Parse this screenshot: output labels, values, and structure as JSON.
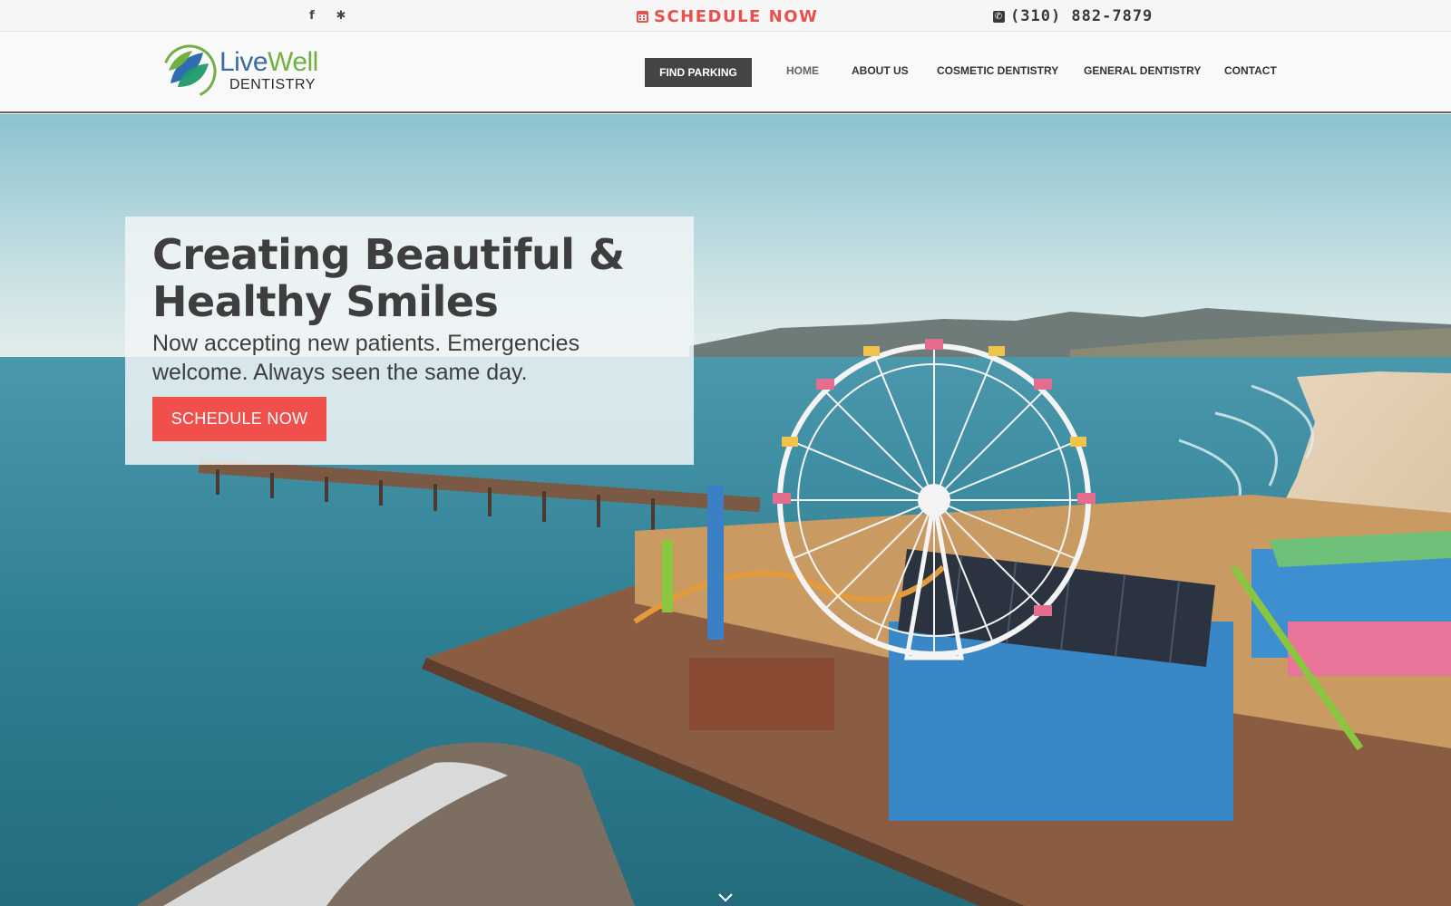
{
  "topbar": {
    "social": [
      {
        "name": "facebook-icon",
        "glyph": "f"
      },
      {
        "name": "yelp-icon",
        "glyph": "✱"
      }
    ],
    "schedule_label": "SCHEDULE NOW",
    "phone": "(310) 882-7879"
  },
  "header": {
    "logo": {
      "live": "Live",
      "well": "Well",
      "dentistry": "DENTISTRY"
    },
    "find_parking_label": "FIND PARKING",
    "nav": [
      "HOME",
      "ABOUT US",
      "COSMETIC DENTISTRY",
      "GENERAL DENTISTRY",
      "CONTACT"
    ],
    "active_nav": "HOME"
  },
  "hero": {
    "title": "Creating Beautiful & Healthy Smiles",
    "subtitle": "Now accepting new patients. Emergencies welcome. Always seen the same day.",
    "cta_label": "SCHEDULE NOW"
  },
  "colors": {
    "accent_red": "#f04f4c",
    "schedule_red": "#e8504c",
    "nav_dark": "#444444",
    "logo_blue": "#3b6aa8",
    "logo_green": "#72b042"
  },
  "icons": [
    "facebook-icon",
    "yelp-icon",
    "calendar-icon",
    "phone-icon",
    "chevron-down-icon"
  ]
}
